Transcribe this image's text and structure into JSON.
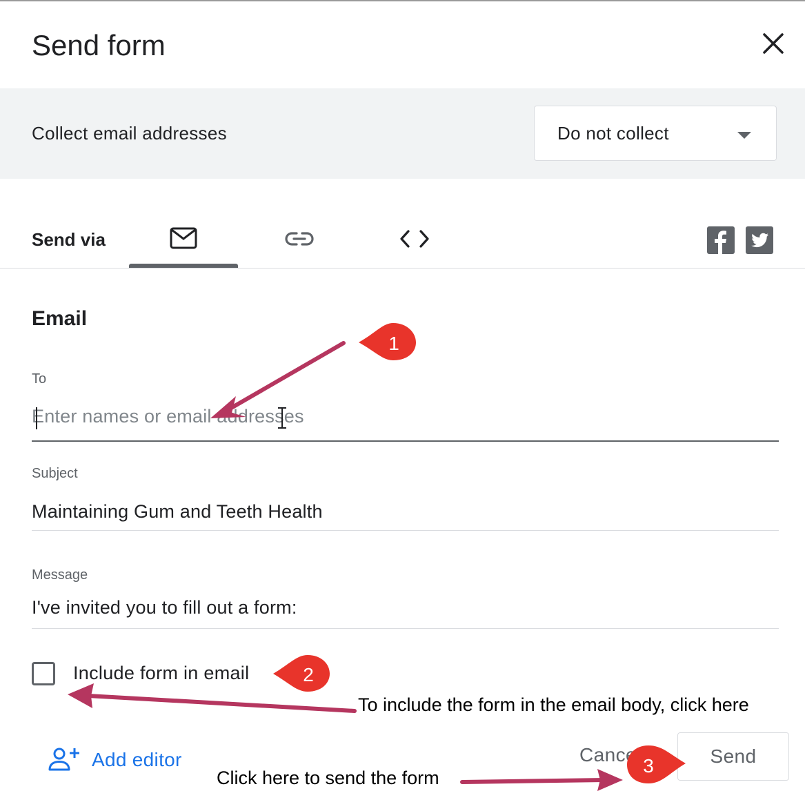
{
  "dialog": {
    "title": "Send form"
  },
  "collect": {
    "label": "Collect email addresses",
    "selected": "Do not collect"
  },
  "send_via": {
    "label": "Send via",
    "tabs": [
      {
        "icon": "email-icon",
        "active": true
      },
      {
        "icon": "link-icon",
        "active": false
      },
      {
        "icon": "embed-code-icon",
        "active": false
      }
    ],
    "social": [
      "facebook-icon",
      "twitter-icon"
    ]
  },
  "email": {
    "section_title": "Email",
    "to_label": "To",
    "to_placeholder": "Enter names or email addresses",
    "subject_label": "Subject",
    "subject_value": "Maintaining Gum and Teeth Health",
    "message_label": "Message",
    "message_value": "I've invited you to fill out a form:",
    "include_label": "Include form in email"
  },
  "footer": {
    "add_editor": "Add editor",
    "cancel": "Cancel",
    "send": "Send"
  },
  "annotations": {
    "marker_1": "1",
    "marker_2": "2",
    "marker_3": "3",
    "note_include": "To include the form in the email body, click here",
    "note_send": "Click here to send the form"
  },
  "colors": {
    "band": "#f1f3f4",
    "accent_blue": "#1a73e8",
    "arrow": "#b5365f",
    "marker": "#e8342b"
  }
}
